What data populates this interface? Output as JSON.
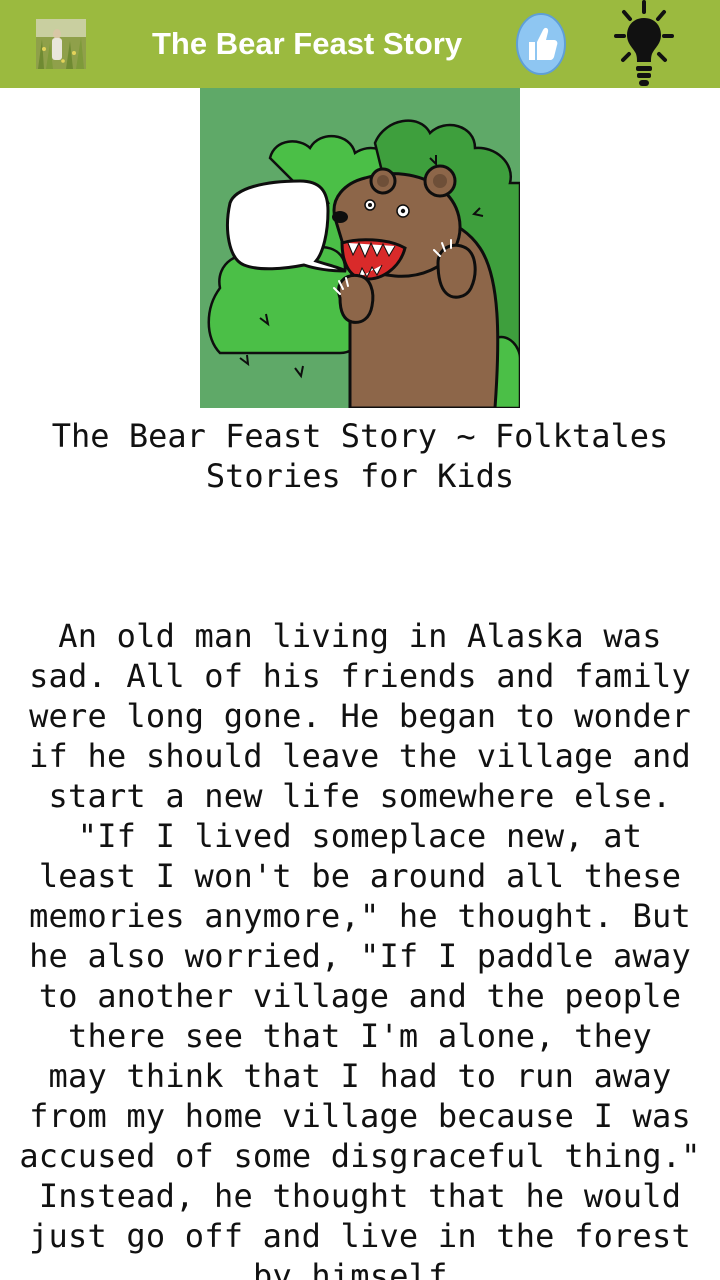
{
  "toolbar": {
    "title": "The Bear Feast Story",
    "app_icon": "meadow-photo-icon",
    "like_icon": "thumbs-up-icon",
    "idea_icon": "lightbulb-icon",
    "background_color": "#9bba3f"
  },
  "story": {
    "title": "The Bear Feast Story ~ Folktales\nStories for Kids",
    "body": "An old man living in Alaska was\nsad.  All of his friends and family\nwere long gone.  He began to wonder\nif he should leave the village and\nstart a new life somewhere else.\n\"If I lived someplace new, at\nleast I won't be around all these\nmemories anymore,\" he thought.  But\nhe also worried, \"If I paddle away\nto another village and the people\nthere see that I'm alone, they\nmay think that I had to run away\nfrom my home village because I was\naccused of some disgraceful thing.\"\nInstead, he thought that he would\njust go off and live in the forest\nby himself."
  }
}
